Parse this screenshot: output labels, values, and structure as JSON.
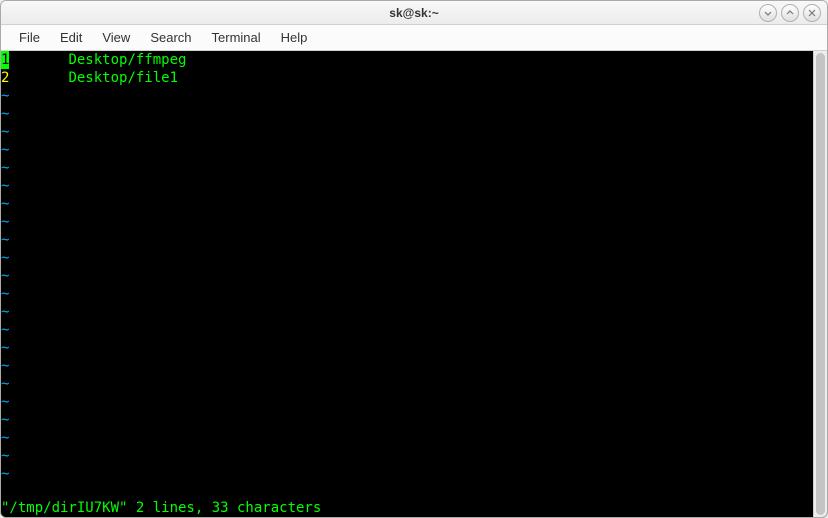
{
  "window": {
    "title": "sk@sk:~"
  },
  "menubar": {
    "items": [
      "File",
      "Edit",
      "View",
      "Search",
      "Terminal",
      "Help"
    ]
  },
  "editor": {
    "lines": [
      {
        "num": "1",
        "gap": "       ",
        "text": "Desktop/ffmpeg"
      },
      {
        "num": "2",
        "gap": "       ",
        "text": "Desktop/file1"
      }
    ],
    "tilde": "~",
    "status": "\"/tmp/dirIU7KW\" 2 lines, 33 characters"
  },
  "window_controls": {
    "minimize": "–",
    "maximize": "⌃",
    "close": "✕"
  }
}
